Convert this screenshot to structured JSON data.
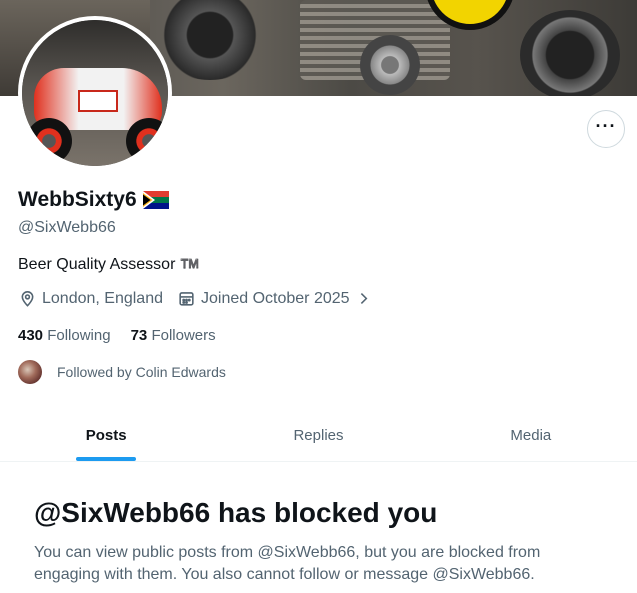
{
  "profile": {
    "display_name": "WebbSixty6",
    "flag_icon": "south-africa-flag-icon",
    "handle": "@SixWebb66",
    "bio": "Beer Quality Assessor ™️",
    "location": "London, England",
    "joined": "Joined October 2025"
  },
  "stats": {
    "following_count": "430",
    "following_label": "Following",
    "followers_count": "73",
    "followers_label": "Followers"
  },
  "followed_by": "Followed by Colin Edwards",
  "tabs": [
    {
      "label": "Posts",
      "active": true
    },
    {
      "label": "Replies",
      "active": false
    },
    {
      "label": "Media",
      "active": false
    }
  ],
  "blocked": {
    "title": "@SixWebb66 has blocked you",
    "message": "You can view public posts from @SixWebb66, but you are blocked from engaging with them. You also cannot follow or message @SixWebb66."
  },
  "colors": {
    "accent": "#1d9bf0",
    "text_primary": "#0f1419",
    "text_secondary": "#536471"
  }
}
